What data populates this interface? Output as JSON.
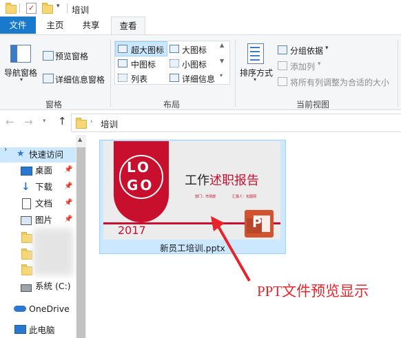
{
  "title_bar": {
    "path": "培训"
  },
  "tabs": {
    "file": "文件",
    "home": "主页",
    "share": "共享",
    "view": "查看"
  },
  "ribbon": {
    "panes": {
      "nav_pane": "导航窗格",
      "preview_pane": "预览窗格",
      "details_pane": "详细信息窗格",
      "group_label": "窗格"
    },
    "layout": {
      "extra_large_icons": "超大图标",
      "large_icons": "大图标",
      "medium_icons": "中图标",
      "small_icons": "小图标",
      "list": "列表",
      "details": "详细信息",
      "group_label": "布局"
    },
    "current_view": {
      "sort_by": "排序方式",
      "group_by": "分组依据",
      "add_column": "添加列",
      "size_all_columns": "将所有列调整为合适的大小",
      "group_label": "当前视图"
    }
  },
  "address": {
    "crumb": "培训"
  },
  "sidebar": {
    "quick_access": "快速访问",
    "items": [
      {
        "label": "桌面",
        "icon": "desktop-icon"
      },
      {
        "label": "下载",
        "icon": "download-icon"
      },
      {
        "label": "文档",
        "icon": "documents-icon"
      },
      {
        "label": "图片",
        "icon": "pictures-icon"
      }
    ],
    "drive_c": "系统 (C:)",
    "onedrive": "OneDrive",
    "this_pc": "此电脑"
  },
  "file": {
    "name": "新员工培训.pptx",
    "thumbnail": {
      "logo_top": "LO",
      "logo_bottom": "GO",
      "title_a": "工作",
      "title_b": "述职报告",
      "meta_dept": "部门：市场部",
      "meta_person": "汇报人：包图网",
      "year": "2017"
    }
  },
  "annotation": {
    "text": "PPT文件预览显示"
  },
  "colors": {
    "accent": "#1979ca",
    "ppt_red": "#c8102e",
    "selection": "#cce8ff"
  }
}
